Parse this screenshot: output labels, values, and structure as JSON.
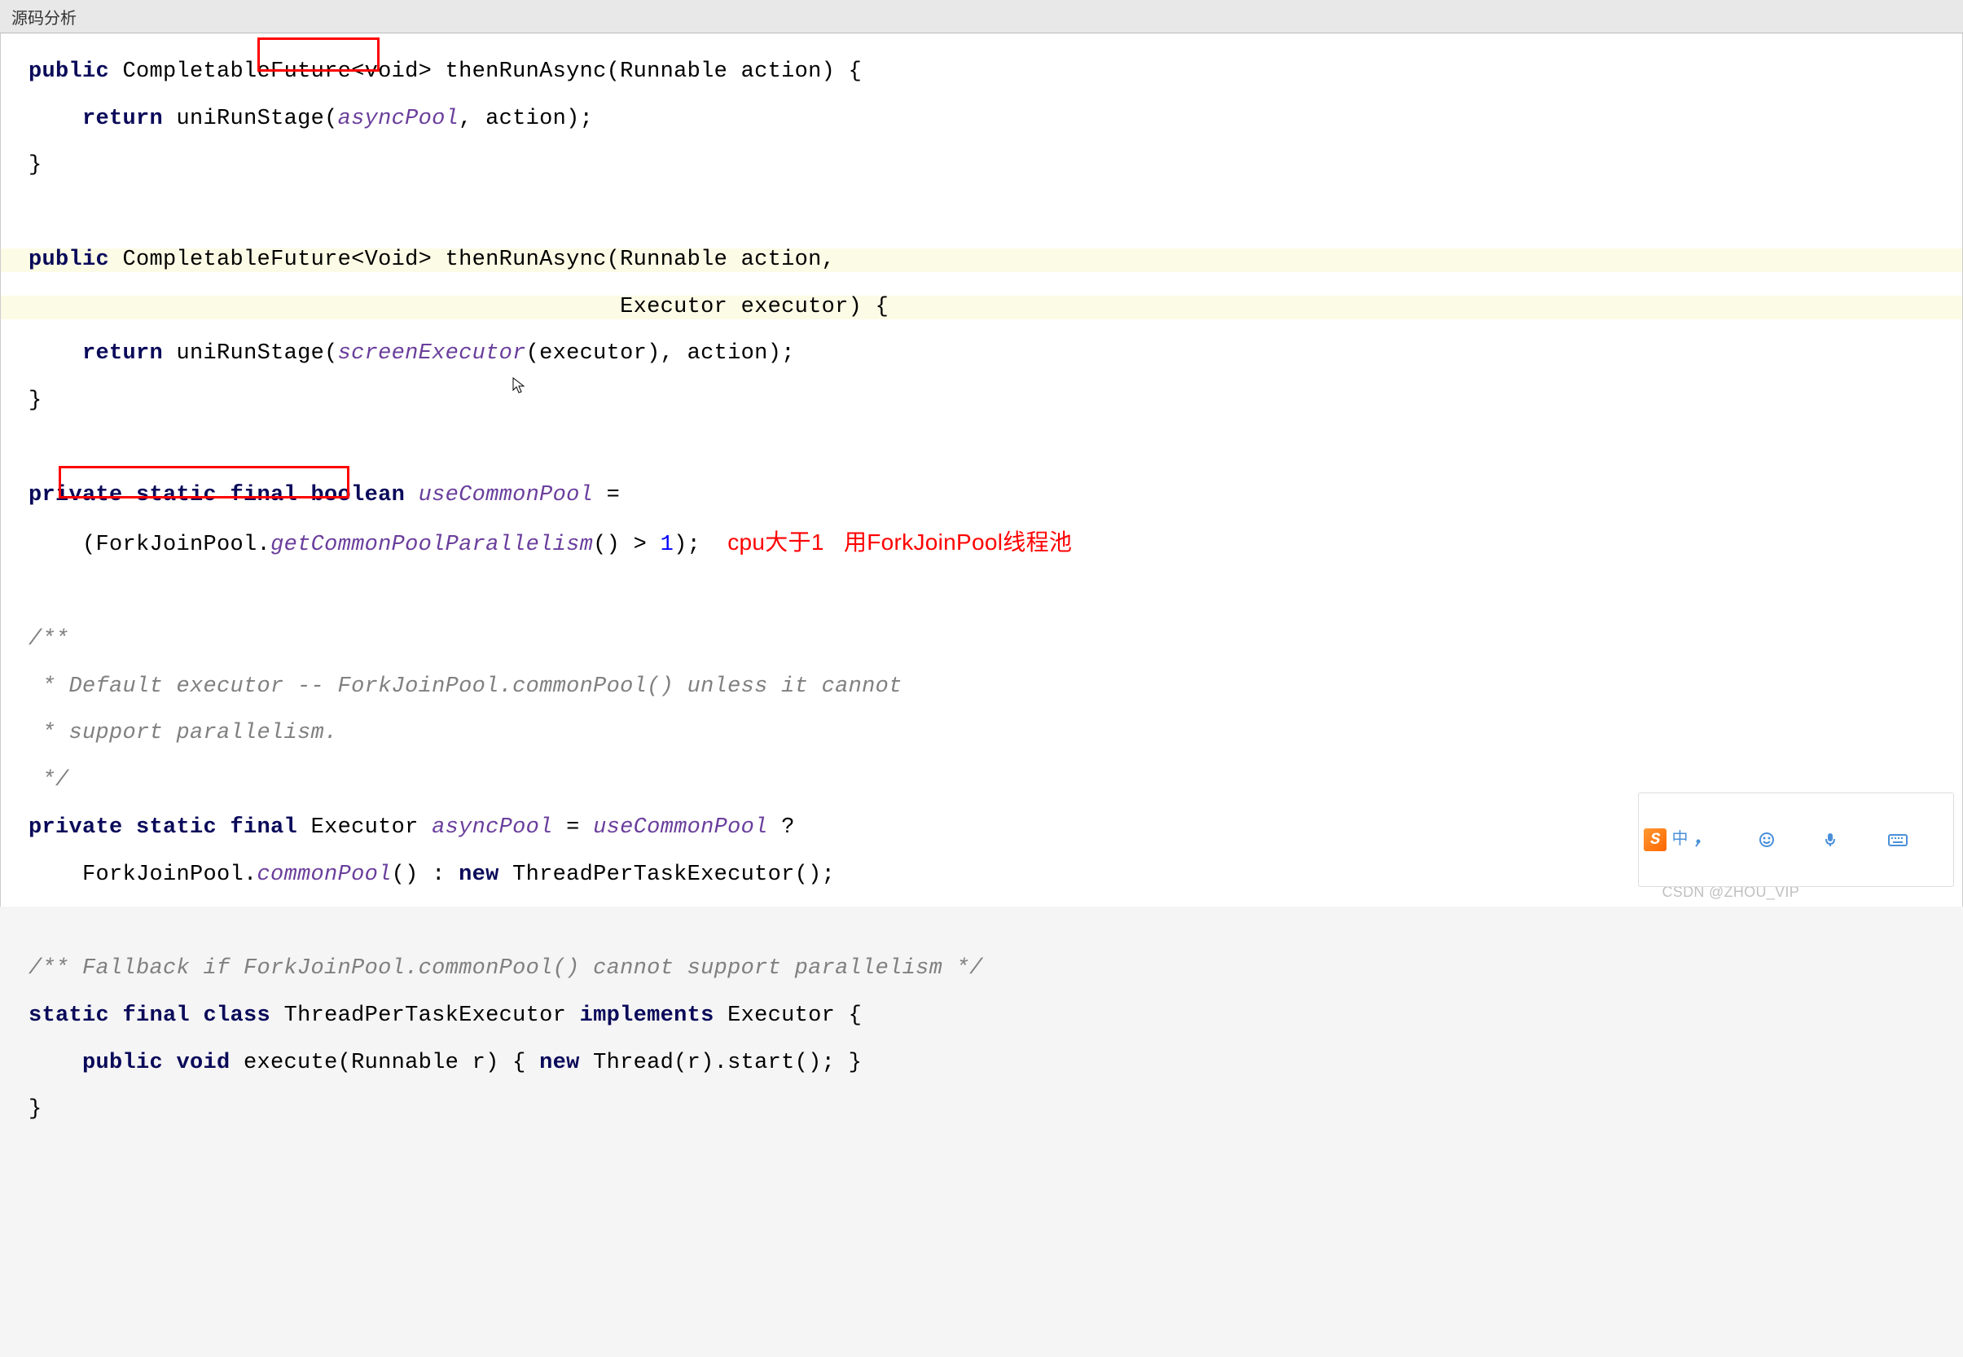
{
  "tab": {
    "title": "源码分析"
  },
  "annotation": {
    "text": "cpu大于1   用ForkJoinPool线程池"
  },
  "watermark": "CSDN @ZHOU_VIP",
  "ime": {
    "lang": "中"
  },
  "code": {
    "l1": {
      "kw1": "public",
      "t1": " CompletableFuture<void> thenRunAsync(Runnable action) {"
    },
    "l2": {
      "kw1": "return",
      "t1": " uniRunStage(",
      "f1": "asyncPool",
      "t2": ", action);"
    },
    "l3": {
      "t1": "}"
    },
    "l5": {
      "kw1": "public",
      "t1": " CompletableFuture<Void> thenRunAsync(Runnable action,"
    },
    "l6": {
      "t1": "                                            Executor executor) {"
    },
    "l7": {
      "kw1": "return",
      "t1": " uniRunStage(",
      "f1": "screenExecutor",
      "t2": "(executor), action);"
    },
    "l8": {
      "t1": "}"
    },
    "l10": {
      "kw1": "private static final boolean",
      "f1": " useCommonPool",
      "t2": " ="
    },
    "l11": {
      "t1": "    (ForkJoinPool.",
      "f1": "getCommonPoolParallelism",
      "t2": "() > ",
      "n1": "1",
      "t3": ");"
    },
    "l13": {
      "c1": "/**"
    },
    "l14": {
      "c1": " * Default executor -- ForkJoinPool.commonPool() unless it cannot"
    },
    "l15": {
      "c1": " * support parallelism."
    },
    "l16": {
      "c1": " */"
    },
    "l17": {
      "kw1": "private static final",
      "t1": " Executor ",
      "f1": "asyncPool",
      "t2": " = ",
      "f2": "useCommonPool",
      "t3": " ?"
    },
    "l18": {
      "t1": "    ForkJoinPool.",
      "f1": "commonPool",
      "t2": "() : ",
      "kw1": "new",
      "t3": " ThreadPerTaskExecutor();"
    },
    "l20": {
      "c1": "/** Fallback if ForkJoinPool.commonPool() cannot support parallelism */"
    },
    "l21": {
      "kw1": "static final class",
      "t1": " ThreadPerTaskExecutor ",
      "kw2": "implements",
      "t2": " Executor {"
    },
    "l22": {
      "kw1": "public void",
      "t1": " execute(Runnable r) { ",
      "kw2": "new",
      "t2": " Thread(r).start(); }"
    },
    "l23": {
      "t1": "}"
    }
  }
}
